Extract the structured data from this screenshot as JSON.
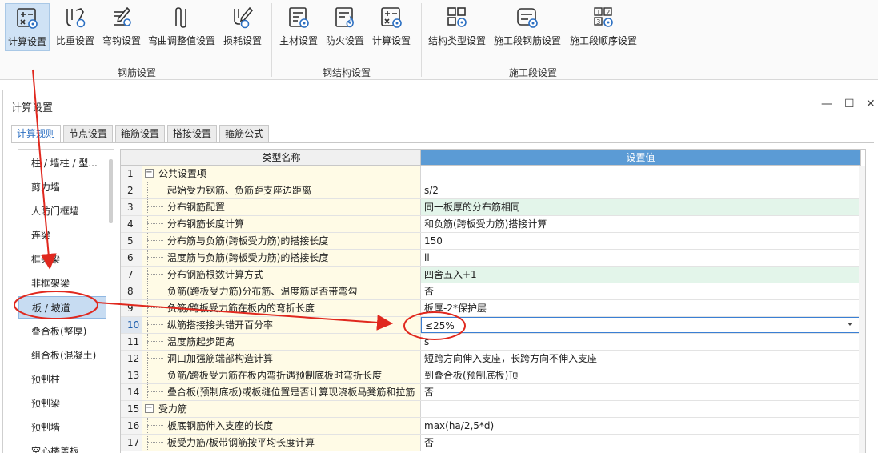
{
  "ribbon": {
    "buttons": [
      {
        "label": "计算设置",
        "icon": "calc-settings-icon",
        "active": true
      },
      {
        "label": "比重设置",
        "icon": "ratio-settings-icon"
      },
      {
        "label": "弯钩设置",
        "icon": "hook-settings-icon"
      },
      {
        "label": "弯曲调整值设置",
        "icon": "bend-adjust-icon"
      },
      {
        "label": "损耗设置",
        "icon": "loss-settings-icon"
      },
      {
        "label": "主材设置",
        "icon": "main-material-icon"
      },
      {
        "label": "防火设置",
        "icon": "fire-settings-icon"
      },
      {
        "label": "计算设置",
        "icon": "calc-settings-icon"
      },
      {
        "label": "结构类型设置",
        "icon": "structure-type-icon"
      },
      {
        "label": "施工段钢筋设置",
        "icon": "stage-rebar-icon"
      },
      {
        "label": "施工段顺序设置",
        "icon": "stage-order-icon"
      }
    ],
    "groups": [
      "钢筋设置",
      "钢结构设置",
      "施工段设置"
    ]
  },
  "dialog": {
    "title": "计算设置",
    "tabs": [
      "计算规则",
      "节点设置",
      "箍筋设置",
      "搭接设置",
      "箍筋公式"
    ],
    "active_tab": 0
  },
  "left_list": {
    "items": [
      "柱 / 墙柱 / 型...",
      "剪力墙",
      "人防门框墙",
      "连梁",
      "框架梁",
      "非框架梁",
      "板 / 坡道",
      "叠合板(整厚)",
      "组合板(混凝土)",
      "预制柱",
      "预制梁",
      "预制墙",
      "空心楼盖板"
    ],
    "selected": "板 / 坡道"
  },
  "grid": {
    "headers": {
      "name": "类型名称",
      "value": "设置值"
    },
    "rows": [
      {
        "num": "1",
        "name": "公共设置项",
        "value": "",
        "group": true
      },
      {
        "num": "2",
        "name": "起始受力钢筋、负筋距支座边距离",
        "value": "s/2"
      },
      {
        "num": "3",
        "name": "分布钢筋配置",
        "value": "同一板厚的分布筋相同",
        "highlight": true
      },
      {
        "num": "4",
        "name": "分布钢筋长度计算",
        "value": "和负筋(跨板受力筋)搭接计算"
      },
      {
        "num": "5",
        "name": "分布筋与负筋(跨板受力筋)的搭接长度",
        "value": "150"
      },
      {
        "num": "6",
        "name": "温度筋与负筋(跨板受力筋)的搭接长度",
        "value": "ll"
      },
      {
        "num": "7",
        "name": "分布钢筋根数计算方式",
        "value": "四舍五入+1",
        "highlight": true
      },
      {
        "num": "8",
        "name": "负筋(跨板受力筋)分布筋、温度筋是否带弯勾",
        "value": "否"
      },
      {
        "num": "9",
        "name": "负筋/跨板受力筋在板内的弯折长度",
        "value": "板厚-2*保护层"
      },
      {
        "num": "10",
        "name": "纵筋搭接接头错开百分率",
        "value": "≤25%",
        "editing": true
      },
      {
        "num": "11",
        "name": "温度筋起步距离",
        "value": "s"
      },
      {
        "num": "12",
        "name": "洞口加强筋端部构造计算",
        "value": "短跨方向伸入支座，长跨方向不伸入支座"
      },
      {
        "num": "13",
        "name": "负筋/跨板受力筋在板内弯折遇预制底板时弯折长度",
        "value": "到叠合板(预制底板)顶"
      },
      {
        "num": "14",
        "name": "叠合板(预制底板)或板缝位置是否计算现浇板马凳筋和拉筋",
        "value": "否"
      },
      {
        "num": "15",
        "name": "受力筋",
        "value": "",
        "group": true
      },
      {
        "num": "16",
        "name": "板底钢筋伸入支座的长度",
        "value": "max(ha/2,5*d)"
      },
      {
        "num": "17",
        "name": "板受力筋/板带钢筋按平均长度计算",
        "value": "否"
      }
    ]
  },
  "colors": {
    "accent": "#2b6fc2",
    "annotation": "#e0281e",
    "header_value_bg": "#5b9bd5"
  }
}
